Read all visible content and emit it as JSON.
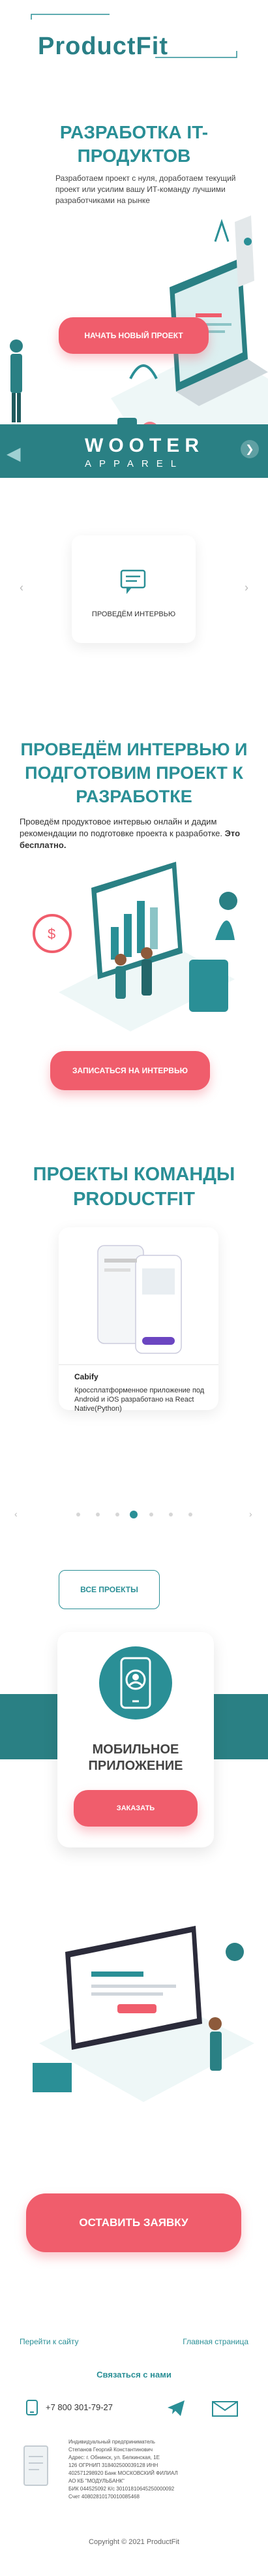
{
  "brand": {
    "logo_text": "ProductFit",
    "accent": "#2a8f96",
    "cta_color": "#f05d6c"
  },
  "hero": {
    "title": "РАЗРАБОТКА IT-ПРОДУКТОВ",
    "description": "Разработаем проект с нуля, доработаем текущий проект или усилим вашу ИТ-команду лучшими разработчиками на рынке",
    "cta": "НАЧАТЬ НОВЫЙ ПРОЕКТ"
  },
  "banner": {
    "brand": "WOOTER",
    "subtitle": "APPAREL"
  },
  "interview_card": {
    "label": "ПРОВЕДЁМ ИНТЕРВЬЮ"
  },
  "interview": {
    "title": "ПРОВЕДЁМ ИНТЕРВЬЮ И ПОДГОТОВИМ ПРОЕКТ К РАЗРАБОТКЕ",
    "description": "Проведём продуктовое интервью онлайн и дадим рекомендации по подготовке проекта к разработке.",
    "description_bold": "Это бесплатно.",
    "cta": "ЗАПИСАТЬСЯ НА ИНТЕРВЬЮ"
  },
  "projects": {
    "title": "ПРОЕКТЫ КОМАНДЫ PRODUCTFIT",
    "card": {
      "name": "Cabify",
      "description": "Кроссплатформенное приложение под Android и iOS разработано на React Native(Python)"
    },
    "all_button": "ВСЕ ПРОЕКТЫ"
  },
  "mobile": {
    "title": "МОБИЛЬНОЕ ПРИЛОЖЕНИЕ",
    "cta": "ЗАКАЗАТЬ"
  },
  "order": {
    "cta": "ОСТАВИТЬ ЗАЯВКУ"
  },
  "footer": {
    "link_site": "Перейти к сайту",
    "link_home": "Главная страница",
    "contact_heading": "Связаться с нами",
    "phone": "+7 800 301-79-27",
    "legal_lines": [
      "Индивидуальный предприниматель",
      "Степанов Георгий Константинович",
      "Адрес: г. Обнинск, ул. Белкинская, 1Е",
      "126 ОГРНИП 318402500039128 ИНН",
      "402571298920 Банк МОСКОВСКИЙ ФИЛИАЛ",
      "АО КБ \"МОДУЛЬБАНК\"",
      "БИК 044525092 К/с 30101810645250000092",
      "Счет 40802810170010085468"
    ],
    "copyright": "Copyright © 2021 ProductFit"
  }
}
